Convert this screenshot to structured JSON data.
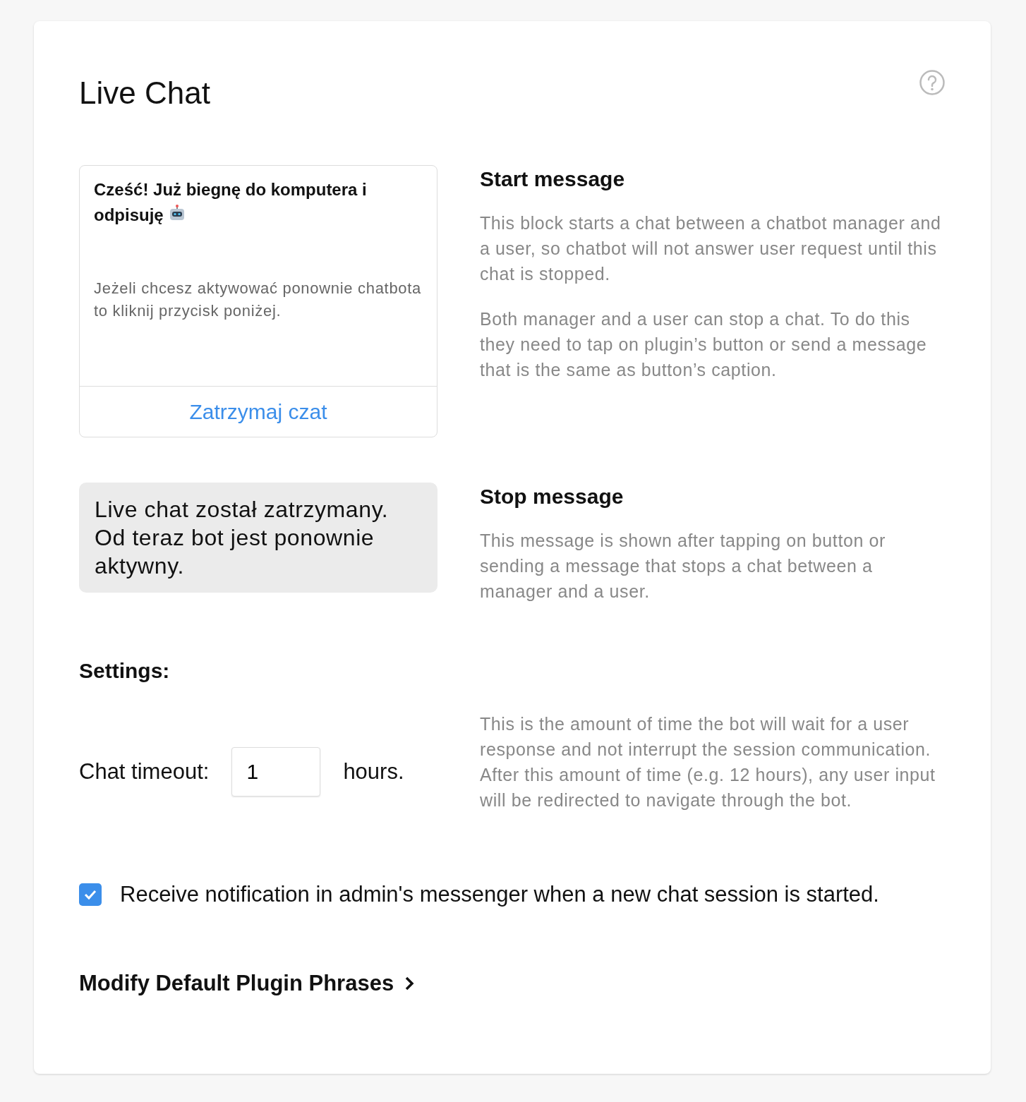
{
  "title": "Live Chat",
  "start": {
    "preview_title": "Cześć! Już biegnę do komputera i odpisuję",
    "preview_text": "Jeżeli chcesz aktywować ponownie chatbota to kliknij przycisk poniżej.",
    "button": "Zatrzymaj czat",
    "heading": "Start message",
    "paragraphs": [
      "This block starts a chat between a chatbot manager and a user, so chatbot will not answer user request until this chat is stopped.",
      "Both manager and a user can stop a chat. To do this they need to tap on plugin’s button or send a message that is the same as button’s caption."
    ]
  },
  "stop": {
    "preview_text": "Live chat został zatrzymany. Od teraz bot jest ponownie aktywny.",
    "heading": "Stop message",
    "paragraphs": [
      "This message is shown after tapping on button or sending a message that stops a chat between a manager and a user."
    ]
  },
  "settings": {
    "heading": "Settings:",
    "timeout_label": "Chat timeout:",
    "timeout_value": "1",
    "timeout_unit": "hours.",
    "timeout_help": "This is the amount of time the bot will wait for a user response and not interrupt the session communication. After this amount of time (e.g. 12 hours), any user input will be redirected to navigate through the bot.",
    "notify": {
      "label": "Receive notification in admin's messenger when a new chat session is started.",
      "checked": true
    }
  },
  "link": "Modify Default Plugin Phrases"
}
